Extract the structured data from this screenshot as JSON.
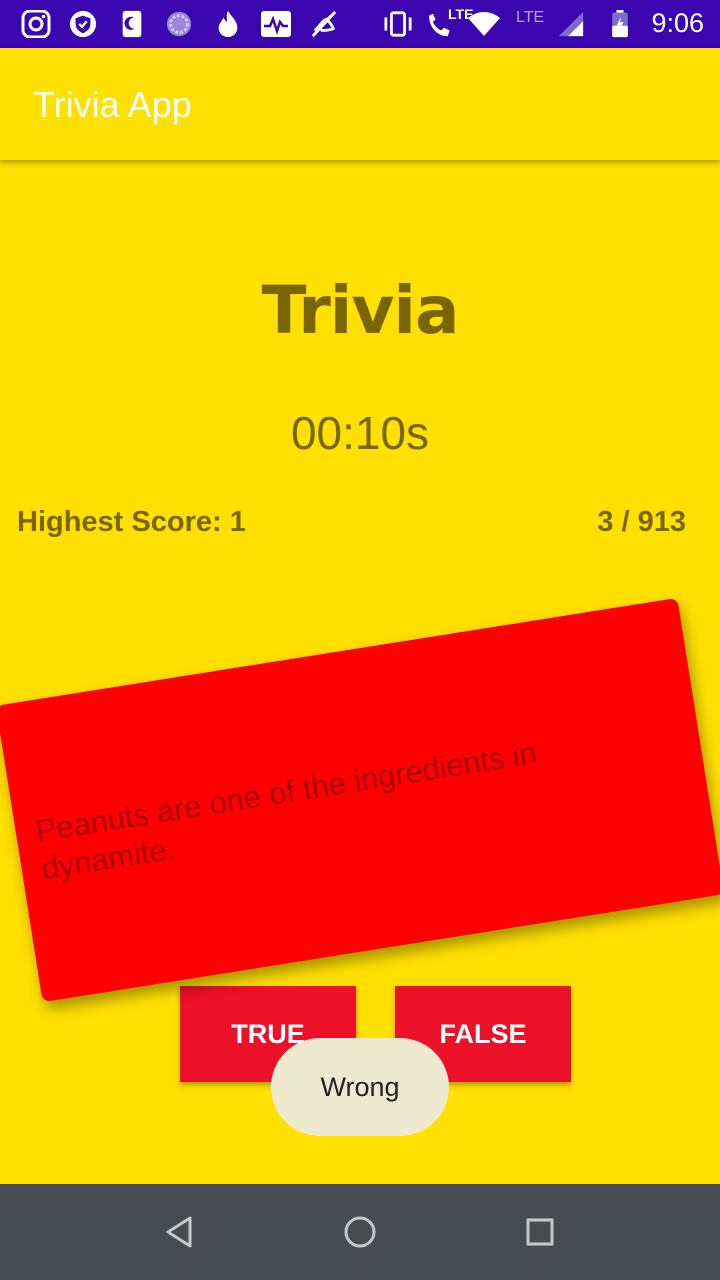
{
  "status_bar": {
    "time": "9:06",
    "network_label": "LTE",
    "icons": [
      "instagram-icon",
      "shield-check-icon",
      "night-mode-icon",
      "circle-spinner-icon",
      "flame-icon",
      "activity-chart-icon",
      "mute-icon",
      "vibrate-icon",
      "lte-call-icon",
      "wifi-icon",
      "signal-icon",
      "battery-charging-icon"
    ]
  },
  "app_bar": {
    "title": "Trivia App"
  },
  "main": {
    "heading": "Trivia",
    "timer": "00:10s",
    "highest_score": "Highest Score: 1",
    "question_counter": "3 / 913",
    "question_text": "Peanuts are one of the ingredients in dynamite.",
    "card_color": "#FF0000",
    "true_label": "TRUE",
    "false_label": "FALSE",
    "accent_button_color": "#EC1028"
  },
  "toast": {
    "message": "Wrong"
  },
  "colors": {
    "background": "#FFE000",
    "status_bar": "#3A06B0",
    "nav_bar": "#474C51",
    "text_dark": "#7A6600"
  }
}
